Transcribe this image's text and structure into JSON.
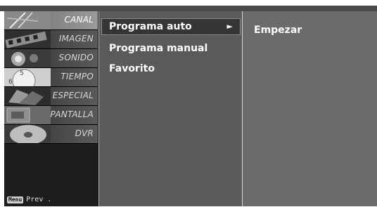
{
  "sidebar": {
    "items": [
      {
        "label": "CANAL",
        "icon": "antenna-icon"
      },
      {
        "label": "IMAGEN",
        "icon": "film-strip-icon"
      },
      {
        "label": "SONIDO",
        "icon": "speaker-icon"
      },
      {
        "label": "TIEMPO",
        "icon": "clock-icon"
      },
      {
        "label": "ESPECIAL",
        "icon": "special-icon"
      },
      {
        "label": "PANTALLA",
        "icon": "screen-icon"
      },
      {
        "label": "DVR",
        "icon": "disc-icon"
      }
    ],
    "active_index": 0,
    "prev_key": "Menu",
    "prev_label": "Prev ."
  },
  "menu": {
    "items": [
      {
        "label": "Programa auto",
        "arrow": "►"
      },
      {
        "label": "Programa manual"
      },
      {
        "label": "Favorito"
      }
    ]
  },
  "submenu": {
    "items": [
      {
        "label": "Empezar"
      }
    ]
  }
}
